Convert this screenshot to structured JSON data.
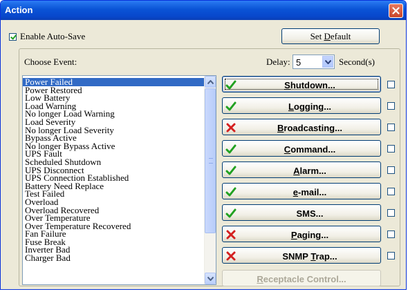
{
  "window": {
    "title": "Action"
  },
  "enable_autosave": {
    "label": "Enable Auto-Save",
    "checked": true
  },
  "set_default": {
    "label_pre": "Set ",
    "label_ul": "D",
    "label_post": "efault"
  },
  "choose_event_label": "Choose Event:",
  "delay": {
    "label": "Delay:",
    "value": "5",
    "unit": "Second(s)"
  },
  "events": [
    "Power Failed",
    "Power Restored",
    "Low Battery",
    "Load Warning",
    "No longer Load Warning",
    "Load Severity",
    "No longer Load Severity",
    "Bypass Active",
    "No longer Bypass Active",
    "UPS Fault",
    "Scheduled Shutdown",
    "UPS Disconnect",
    "UPS Connection Established",
    "Battery Need Replace",
    "Test Failed",
    "Overload",
    "Overload Recovered",
    "Over Temperature",
    "Over Temperature Recovered",
    "Fan Failure",
    "Fuse Break",
    "Inverter Bad",
    "Charger Bad"
  ],
  "selected_event": "Power Failed",
  "actions": [
    {
      "pre": "",
      "ul": "S",
      "post": "hutdown...",
      "status": "enabled",
      "checked": false
    },
    {
      "pre": "",
      "ul": "L",
      "post": "ogging...",
      "status": "enabled",
      "checked": false
    },
    {
      "pre": "",
      "ul": "B",
      "post": "roadcasting...",
      "status": "disabled",
      "checked": false
    },
    {
      "pre": "",
      "ul": "C",
      "post": "ommand...",
      "status": "enabled",
      "checked": false
    },
    {
      "pre": "",
      "ul": "A",
      "post": "larm...",
      "status": "enabled",
      "checked": false
    },
    {
      "pre": "",
      "ul": "e",
      "post": "-mail...",
      "status": "enabled",
      "checked": false
    },
    {
      "pre": "SMS...",
      "ul": "",
      "post": "",
      "status": "enabled",
      "checked": false
    },
    {
      "pre": "",
      "ul": "P",
      "post": "aging...",
      "status": "disabled",
      "checked": false
    },
    {
      "pre": "SNMP ",
      "ul": "T",
      "post": "rap...",
      "status": "disabled",
      "checked": false
    }
  ],
  "receptacle": {
    "pre": "",
    "ul": "R",
    "post": "eceptacle Control..."
  },
  "colors": {
    "enabled_check": "#21a121",
    "disabled_x": "#d42020",
    "titlebar": "#0a53d6",
    "selection": "#316ac5"
  }
}
